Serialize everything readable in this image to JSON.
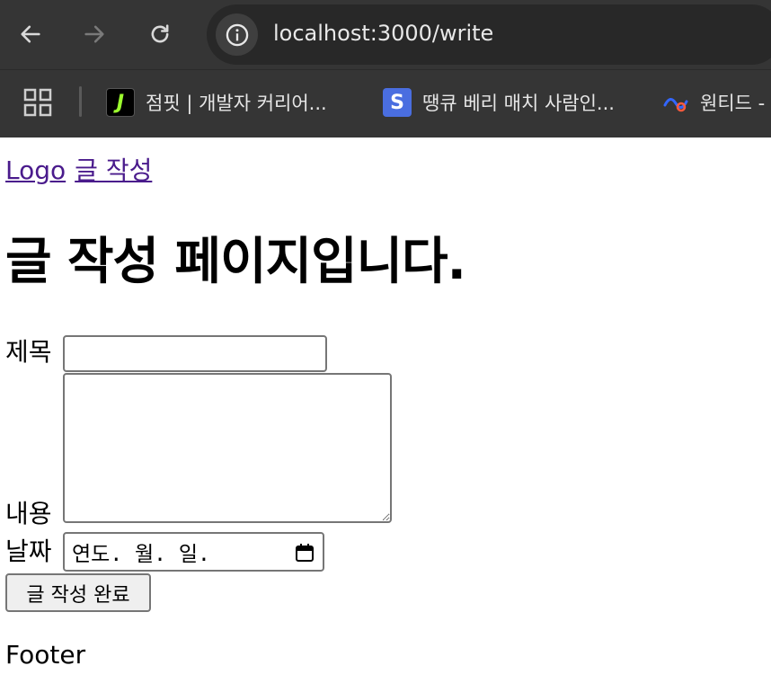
{
  "browser": {
    "url": "localhost:3000/write",
    "bookmarks": [
      {
        "label": "점핏 | 개발자 커리어...",
        "favicon": "jumpit-icon",
        "color": "#000000"
      },
      {
        "label": "땡큐 베리 매치 사람인...",
        "favicon": "saramin-icon",
        "color": "#4a6ee0"
      },
      {
        "label": "원티드 -",
        "favicon": "wanted-icon",
        "color": "#3366ff"
      }
    ],
    "favicon_letters": {
      "jumpit": "J",
      "saramin": "S"
    }
  },
  "nav": {
    "logo_link": "Logo",
    "write_link": "글 작성"
  },
  "main": {
    "page_title": "글 작성 페이지입니다.",
    "form": {
      "title_label": "제목",
      "title_value": "",
      "content_label": "내용",
      "content_value": "",
      "date_label": "날짜",
      "date_placeholder": "연도. 월. 일.",
      "submit_label": "글 작성 완료"
    }
  },
  "footer": {
    "text": "Footer"
  }
}
